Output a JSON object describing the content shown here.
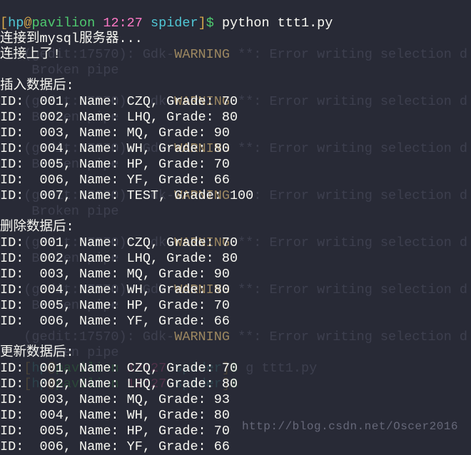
{
  "prompt": {
    "bracket_open": "[",
    "user": "hp",
    "at": "@",
    "host": "pavilion",
    "time": "12:27",
    "dir_prefix": " ",
    "dir": "spider",
    "bracket_close": "]",
    "dollar": "$",
    "command": " python ttt1.py"
  },
  "output": {
    "l1": "连接到mysql服务器...",
    "l2": "连接上了!",
    "l3": "",
    "l4": "插入数据后:",
    "insert": [
      "ID:  001, Name: CZQ, Grade: 70",
      "ID:  002, Name: LHQ, Grade: 80",
      "ID:  003, Name: MQ, Grade: 90",
      "ID:  004, Name: WH, Grade: 80",
      "ID:  005, Name: HP, Grade: 70",
      "ID:  006, Name: YF, Grade: 66",
      "ID:  007, Name: TEST, Grade: 100"
    ],
    "l12": "",
    "l13": "删除数据后:",
    "delete": [
      "ID:  001, Name: CZQ, Grade: 70",
      "ID:  002, Name: LHQ, Grade: 80",
      "ID:  003, Name: MQ, Grade: 90",
      "ID:  004, Name: WH, Grade: 80",
      "ID:  005, Name: HP, Grade: 70",
      "ID:  006, Name: YF, Grade: 66"
    ],
    "l20": "",
    "l21": "更新数据后:",
    "update": [
      "ID:  001, Name: CZQ, Grade: 70",
      "ID:  002, Name: LHQ, Grade: 80",
      "ID:  003, Name: MQ, Grade: 93",
      "ID:  004, Name: WH, Grade: 80",
      "ID:  005, Name: HP, Grade: 70",
      "ID:  006, Name: YF, Grade: 66"
    ]
  },
  "bg": {
    "l1": "",
    "l2": "",
    "l3": "   (gedit:17570): Gdk-WARNING **: Error writing selection d",
    "l4": "    Broken pipe",
    "l5": "",
    "l6": "   (gedit:17570): Gdk-WARNING **: Error writing selection d",
    "l7": "    Broken pipe",
    "l8": "",
    "l9": "   (gedit:17570): Gdk-WARNING **: Error writing selection d",
    "l10": "    Broken pipe",
    "l11": "",
    "l12": "   (gedit:17570): Gdk-WARNING **: Error writing selection d",
    "l13": "    Broken pipe",
    "l14": "",
    "l15": "   (gedit:17570): Gdk-WARNING **: Error writing selection d",
    "l16": "    Broken pipe",
    "l17": "",
    "l18": "   (gedit:17570): Gdk-WARNING **: Error writing selection d",
    "l19": "    Broken pipe",
    "l20": "",
    "l21": "   (gedit:17570): Gdk-WARNING **: Error writing selection d",
    "l22": "    Broken pipe",
    "cmd1_pre": "   ",
    "cmd1_end": " g ttt1.py",
    "cmd2_pre": "   ",
    "cmd2_end": " ",
    "warn": "WARNING"
  },
  "watermark": "http://blog.csdn.net/Oscer2016"
}
